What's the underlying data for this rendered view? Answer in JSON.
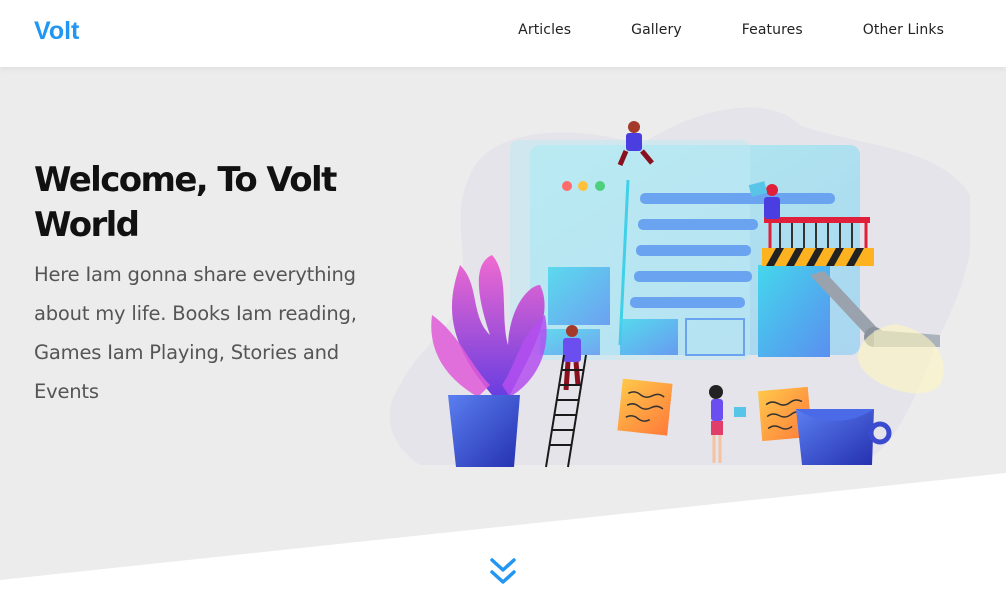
{
  "brand": "Volt",
  "nav": {
    "articles": "Articles",
    "gallery": "Gallery",
    "features": "Features",
    "other_links": "Other Links"
  },
  "hero": {
    "title": "Welcome, To Volt World",
    "text": "Here Iam gonna share everything about my life. Books Iam reading, Games Iam Playing, Stories and Events"
  },
  "colors": {
    "accent": "#2196f3",
    "hero_bg": "#ececec",
    "title": "#111111",
    "body_text": "#555555"
  },
  "icons": {
    "scroll": "double-chevron-down-icon"
  }
}
